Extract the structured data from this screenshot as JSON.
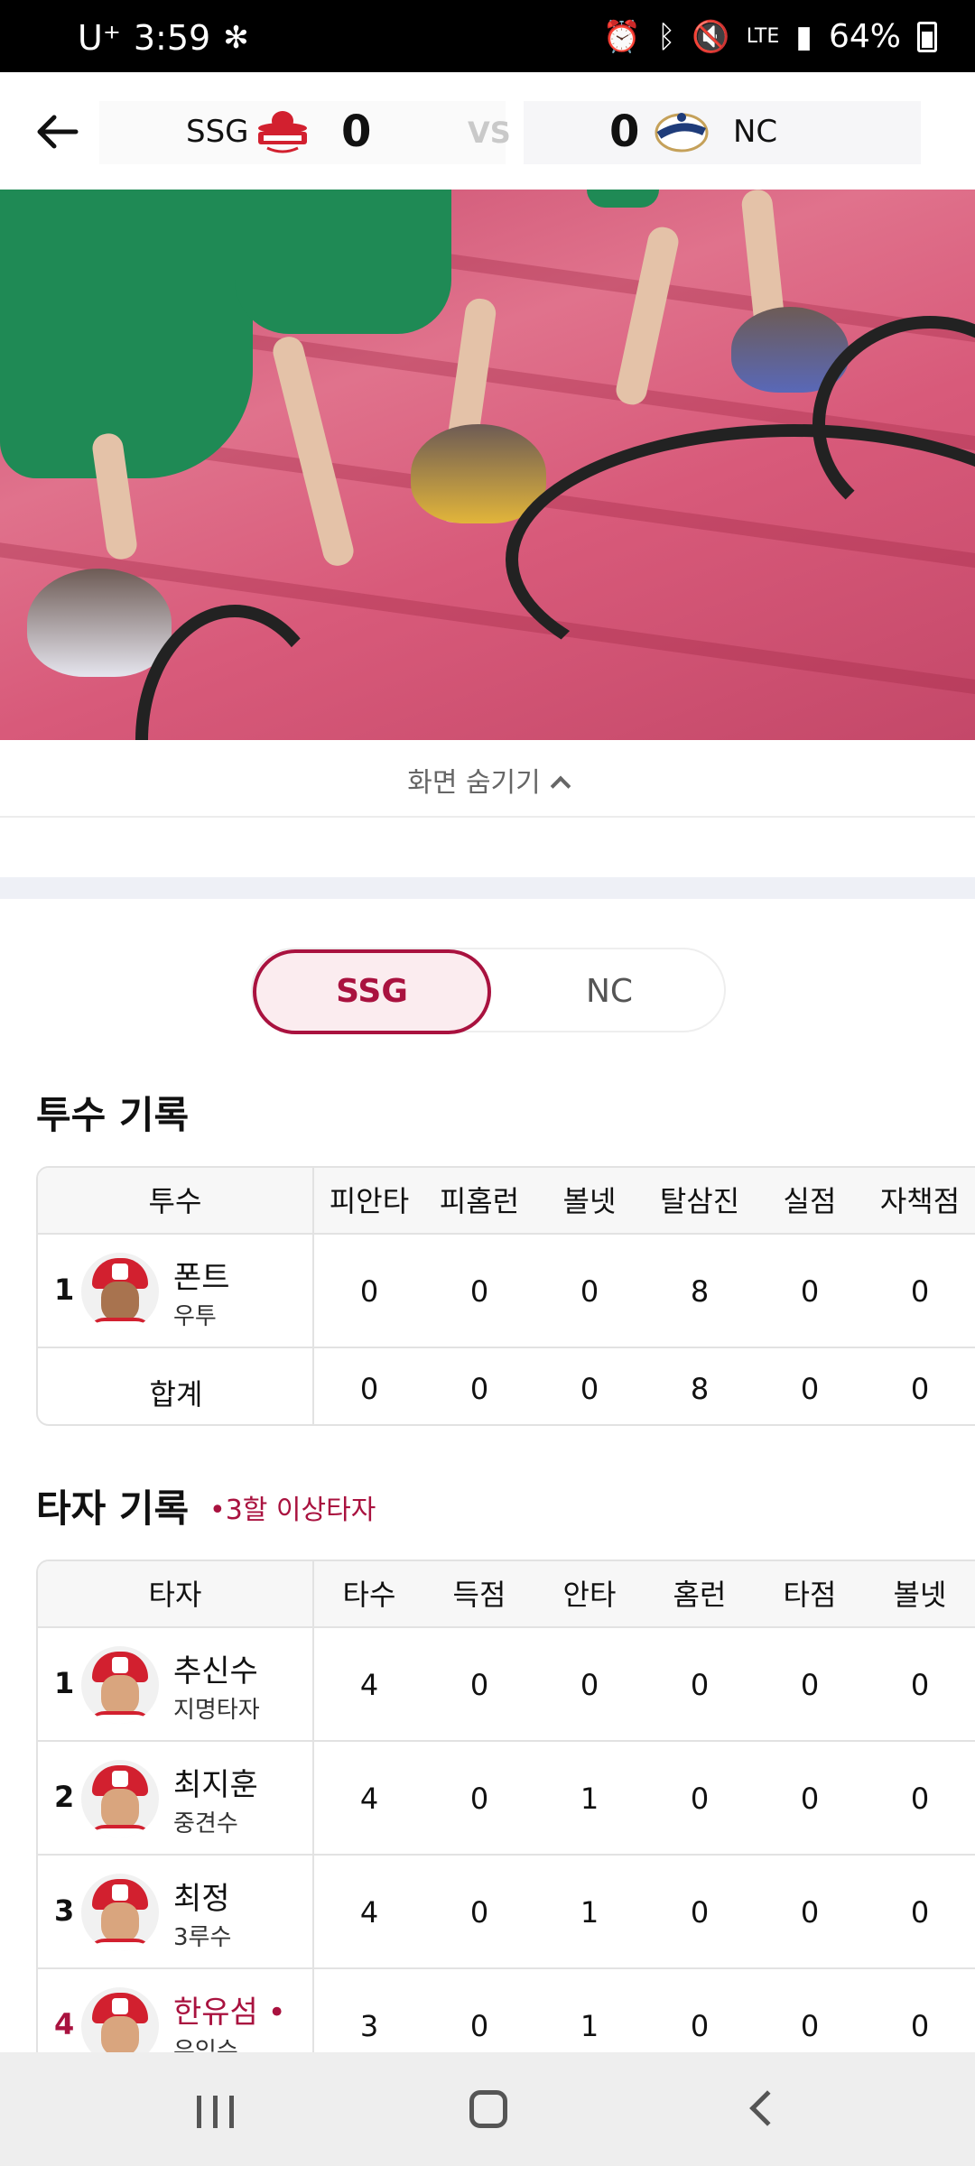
{
  "status_bar": {
    "carrier": "U⁺",
    "time": "3:59",
    "battery": "64%",
    "network": "LTE"
  },
  "header": {
    "away_team": "SSG",
    "away_score": "0",
    "vs": "VS",
    "home_score": "0",
    "home_team": "NC"
  },
  "video": {
    "hide_label": "화면 숨기기"
  },
  "team_toggle": {
    "selected": "SSG",
    "other": "NC"
  },
  "pitching": {
    "title": "투수 기록",
    "headers": [
      "투수",
      "피안타",
      "피홈런",
      "볼넷",
      "탈삼진",
      "실점",
      "자책점"
    ],
    "rows": [
      {
        "num": "1",
        "name": "폰트",
        "position": "우투",
        "stats": [
          "0",
          "0",
          "0",
          "8",
          "0",
          "0"
        ]
      }
    ],
    "total": {
      "label": "합계",
      "stats": [
        "0",
        "0",
        "0",
        "8",
        "0",
        "0"
      ]
    }
  },
  "batting": {
    "title": "타자 기록",
    "note": "•3할 이상타자",
    "headers": [
      "타자",
      "타수",
      "득점",
      "안타",
      "홈런",
      "타점",
      "볼넷"
    ],
    "rows": [
      {
        "num": "1",
        "name": "추신수",
        "position": "지명타자",
        "stats": [
          "4",
          "0",
          "0",
          "0",
          "0",
          "0"
        ]
      },
      {
        "num": "2",
        "name": "최지훈",
        "position": "중견수",
        "stats": [
          "4",
          "0",
          "1",
          "0",
          "0",
          "0"
        ]
      },
      {
        "num": "3",
        "name": "최정",
        "position": "3루수",
        "stats": [
          "4",
          "0",
          "1",
          "0",
          "0",
          "0"
        ]
      },
      {
        "num": "4",
        "name": "한유섬 •",
        "position": "우익수",
        "stats": [
          "3",
          "0",
          "1",
          "0",
          "0",
          "0"
        ]
      }
    ]
  },
  "colors": {
    "accent": "#a9123f",
    "toggle_bg": "#fbecef"
  }
}
